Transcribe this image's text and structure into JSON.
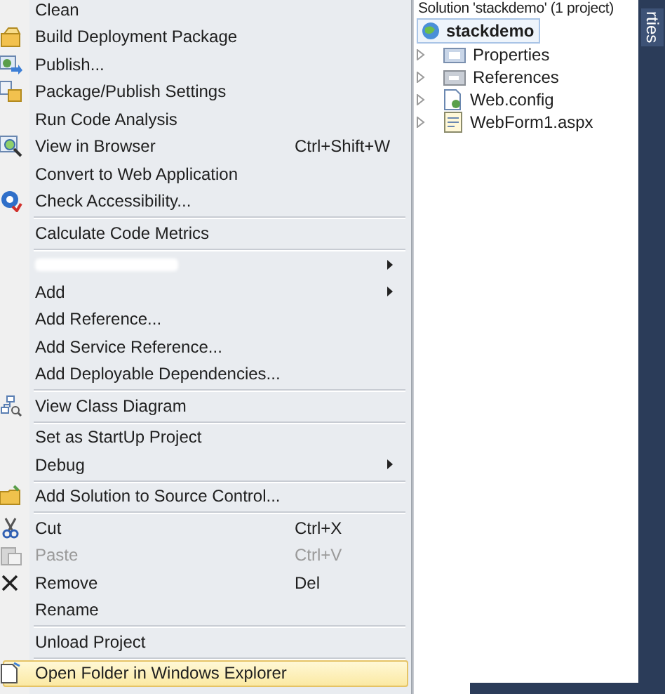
{
  "context_menu": {
    "items": [
      {
        "kind": "item",
        "label": "Clean",
        "selected": false,
        "disabled": false
      },
      {
        "kind": "item",
        "label": "Build Deployment Package",
        "selected": false,
        "disabled": false
      },
      {
        "kind": "item",
        "label": "Publish...",
        "selected": false,
        "disabled": false
      },
      {
        "kind": "item",
        "label": "Package/Publish Settings",
        "selected": false,
        "disabled": false
      },
      {
        "kind": "item",
        "label": "Run Code Analysis",
        "selected": false,
        "disabled": false
      },
      {
        "kind": "item",
        "label": "View in Browser",
        "shortcut": "Ctrl+Shift+W",
        "selected": false,
        "disabled": false
      },
      {
        "kind": "item",
        "label": "Convert to Web Application",
        "selected": false,
        "disabled": false
      },
      {
        "kind": "item",
        "label": "Check Accessibility...",
        "selected": false,
        "disabled": false
      },
      {
        "kind": "separator"
      },
      {
        "kind": "item",
        "label": "Calculate Code Metrics",
        "selected": false,
        "disabled": false
      },
      {
        "kind": "separator"
      },
      {
        "kind": "redacted",
        "submenu": true
      },
      {
        "kind": "item",
        "label": "Add",
        "submenu": true,
        "selected": false,
        "disabled": false
      },
      {
        "kind": "item",
        "label": "Add Reference...",
        "selected": false,
        "disabled": false
      },
      {
        "kind": "item",
        "label": "Add Service Reference...",
        "selected": false,
        "disabled": false
      },
      {
        "kind": "item",
        "label": "Add Deployable Dependencies...",
        "selected": false,
        "disabled": false
      },
      {
        "kind": "separator"
      },
      {
        "kind": "item",
        "label": "View Class Diagram",
        "selected": false,
        "disabled": false
      },
      {
        "kind": "separator"
      },
      {
        "kind": "item",
        "label": "Set as StartUp Project",
        "selected": false,
        "disabled": false
      },
      {
        "kind": "item",
        "label": "Debug",
        "submenu": true,
        "selected": false,
        "disabled": false
      },
      {
        "kind": "separator"
      },
      {
        "kind": "item",
        "label": "Add Solution to Source Control...",
        "selected": false,
        "disabled": false
      },
      {
        "kind": "separator"
      },
      {
        "kind": "item",
        "label": "Cut",
        "shortcut": "Ctrl+X",
        "selected": false,
        "disabled": false
      },
      {
        "kind": "item",
        "label": "Paste",
        "shortcut": "Ctrl+V",
        "selected": false,
        "disabled": true
      },
      {
        "kind": "item",
        "label": "Remove",
        "shortcut": "Del",
        "selected": false,
        "disabled": false
      },
      {
        "kind": "item",
        "label": "Rename",
        "selected": false,
        "disabled": false
      },
      {
        "kind": "separator"
      },
      {
        "kind": "item",
        "label": "Unload Project",
        "selected": false,
        "disabled": false
      },
      {
        "kind": "separator"
      },
      {
        "kind": "item",
        "label": "Open Folder in Windows Explorer",
        "selected": true,
        "disabled": false
      }
    ]
  },
  "solution_explorer": {
    "header": "Solution 'stackdemo' (1 project)",
    "project": {
      "label": "stackdemo",
      "selected": true,
      "children": [
        {
          "label": "Properties"
        },
        {
          "label": "References"
        },
        {
          "label": "Web.config"
        },
        {
          "label": "WebForm1.aspx"
        }
      ]
    }
  },
  "side_tab": {
    "label": "rties"
  }
}
